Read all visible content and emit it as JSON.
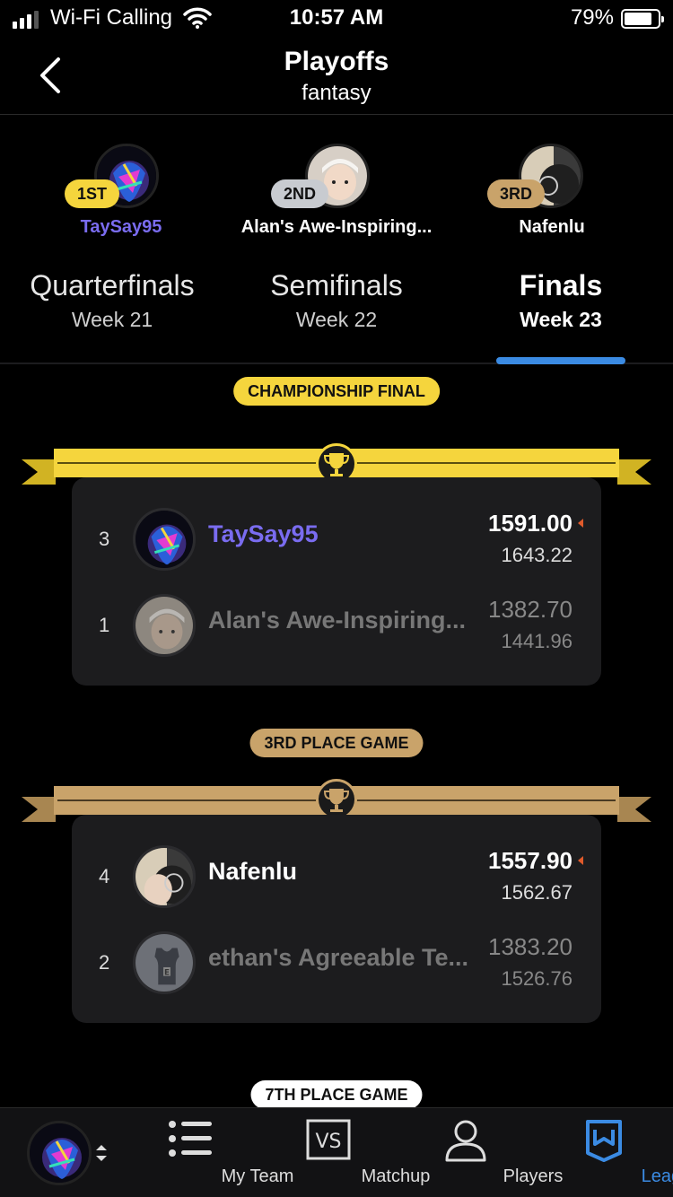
{
  "status": {
    "carrier": "Wi-Fi Calling",
    "time": "10:57 AM",
    "battery": "79%"
  },
  "header": {
    "title": "Playoffs",
    "subtitle": "fantasy"
  },
  "podium": [
    {
      "place": "1ST",
      "name": "TaySay95"
    },
    {
      "place": "2ND",
      "name": "Alan's Awe-Inspiring..."
    },
    {
      "place": "3RD",
      "name": "Nafenlu"
    }
  ],
  "tabs": [
    {
      "round": "Quarterfinals",
      "week": "Week 21"
    },
    {
      "round": "Semifinals",
      "week": "Week 22"
    },
    {
      "round": "Finals",
      "week": "Week 23"
    }
  ],
  "sections": {
    "championship": "CHAMPIONSHIP FINAL",
    "third": "3RD PLACE GAME",
    "seventh": "7TH PLACE GAME"
  },
  "championship": [
    {
      "seed": "3",
      "team": "TaySay95",
      "score": "1591.00",
      "projected": "1643.22"
    },
    {
      "seed": "1",
      "team": "Alan's Awe-Inspiring...",
      "score": "1382.70",
      "projected": "1441.96"
    }
  ],
  "third_place": [
    {
      "seed": "4",
      "team": "Nafenlu",
      "score": "1557.90",
      "projected": "1562.67"
    },
    {
      "seed": "2",
      "team": "ethan's Agreeable Te...",
      "score": "1383.20",
      "projected": "1526.76"
    }
  ],
  "nav": [
    {
      "label": "My Team"
    },
    {
      "label": "Matchup"
    },
    {
      "label": "Players"
    },
    {
      "label": "League"
    }
  ],
  "colors": {
    "gold": "#f5d53d",
    "bronze": "#c9a36a",
    "accent": "#3b8be3",
    "purple": "#7a6cf0"
  }
}
